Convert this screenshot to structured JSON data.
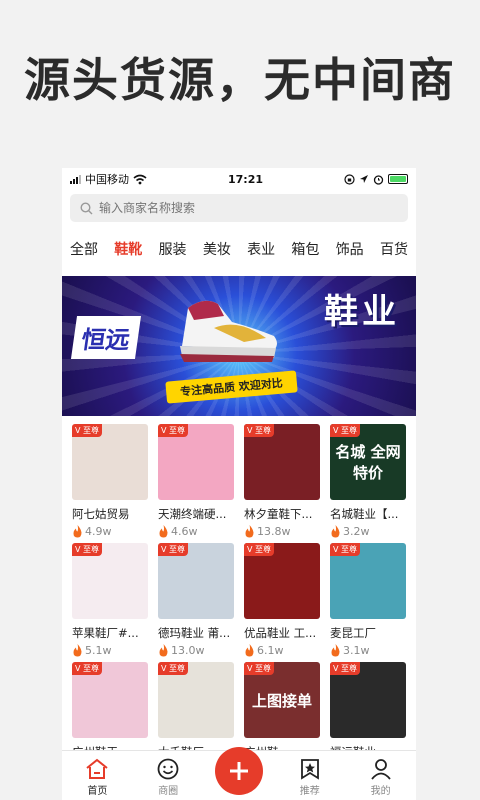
{
  "headline": "源头货源，无中间商",
  "status_bar": {
    "carrier": "中国移动",
    "time": "17:21"
  },
  "search": {
    "placeholder": "输入商家名称搜索"
  },
  "tabs": [
    {
      "label": "全部"
    },
    {
      "label": "鞋靴"
    },
    {
      "label": "服装"
    },
    {
      "label": "美妆"
    },
    {
      "label": "表业"
    },
    {
      "label": "箱包"
    },
    {
      "label": "饰品"
    },
    {
      "label": "百货"
    }
  ],
  "active_tab": "鞋靴",
  "banner": {
    "brand": "恒远",
    "title": "鞋业",
    "slogan": "专注高品质 欢迎对比"
  },
  "badge_label": "V 至尊",
  "shops": [
    {
      "name": "阿七姑贸易",
      "count": "4.9w",
      "thumb_color": "#e9ddd6"
    },
    {
      "name": "天潮终端硬...",
      "count": "4.6w",
      "thumb_color": "#f3a7c2"
    },
    {
      "name": "林夕童鞋下...",
      "count": "13.8w",
      "thumb_color": "#7a1f25"
    },
    {
      "name": "名城鞋业【...",
      "count": "3.2w",
      "thumb_color": "#183a26",
      "thumb_text": "名城 全网 特价"
    },
    {
      "name": "苹果鞋厂#...",
      "count": "5.1w",
      "thumb_color": "#f5ecf0"
    },
    {
      "name": "德玛鞋业 莆...",
      "count": "13.0w",
      "thumb_color": "#c9d3dd"
    },
    {
      "name": "优品鞋业 工...",
      "count": "6.1w",
      "thumb_color": "#8a1a1a"
    },
    {
      "name": "麦昆工厂",
      "count": "3.1w",
      "thumb_color": "#4aa3b6"
    },
    {
      "name": "广州鞋王...",
      "count": "",
      "thumb_color": "#f0c7d8"
    },
    {
      "name": "大千鞋厂...",
      "count": "",
      "thumb_color": "#e6e2da"
    },
    {
      "name": "广州鞋...",
      "count": "",
      "thumb_color": "#7a2e2e",
      "thumb_text": "上图接单"
    },
    {
      "name": "福运鞋业...",
      "count": "",
      "thumb_color": "#2a2a2a"
    }
  ],
  "bottom_nav": [
    {
      "label": "首页",
      "icon": "home-icon"
    },
    {
      "label": "商圈",
      "icon": "smile-circle-icon"
    },
    {
      "label": "",
      "icon": "plus-icon"
    },
    {
      "label": "推荐",
      "icon": "star-bookmark-icon"
    },
    {
      "label": "我的",
      "icon": "person-icon"
    }
  ],
  "colors": {
    "accent": "#e63c2a",
    "banner_blue": "#2a4fd8"
  }
}
